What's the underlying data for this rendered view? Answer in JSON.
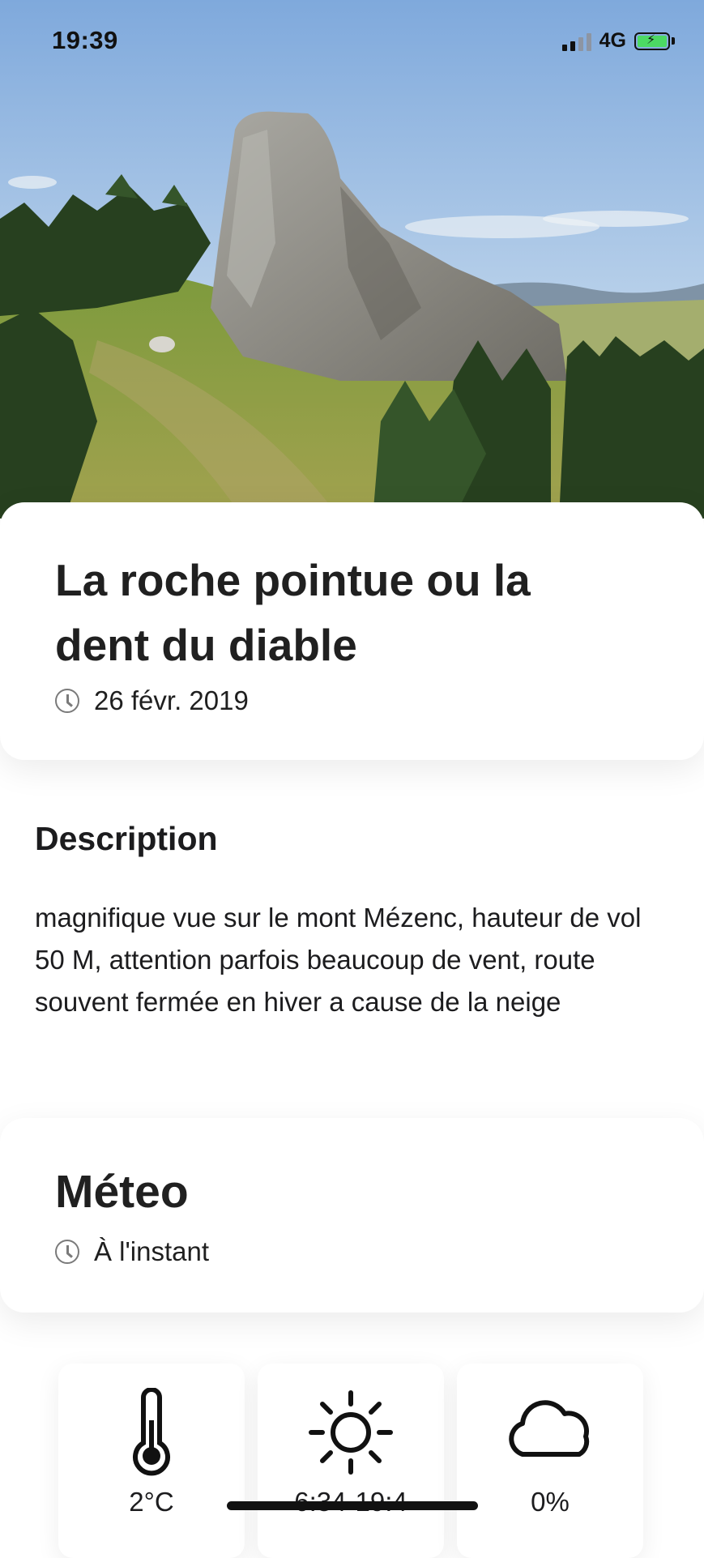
{
  "status_bar": {
    "time": "19:39",
    "network": "4G",
    "battery_charging": true
  },
  "spot": {
    "title": "La roche pointue ou la dent du diable",
    "date": "26 févr. 2019"
  },
  "description": {
    "heading": "Description",
    "text": "magnifique vue sur le mont Mézenc, hauteur de vol 50 M, attention parfois beaucoup de vent, route souvent fermée en hiver a cause de la neige"
  },
  "weather": {
    "title": "Méteo",
    "updated": "À l'instant",
    "tiles": [
      {
        "icon": "thermometer-icon",
        "value": "2°C"
      },
      {
        "icon": "sun-icon",
        "value": "6:34-19:4"
      },
      {
        "icon": "cloud-icon",
        "value": "0%"
      }
    ]
  },
  "colors": {
    "battery": "#4cd964",
    "text": "#1c1c1e"
  }
}
